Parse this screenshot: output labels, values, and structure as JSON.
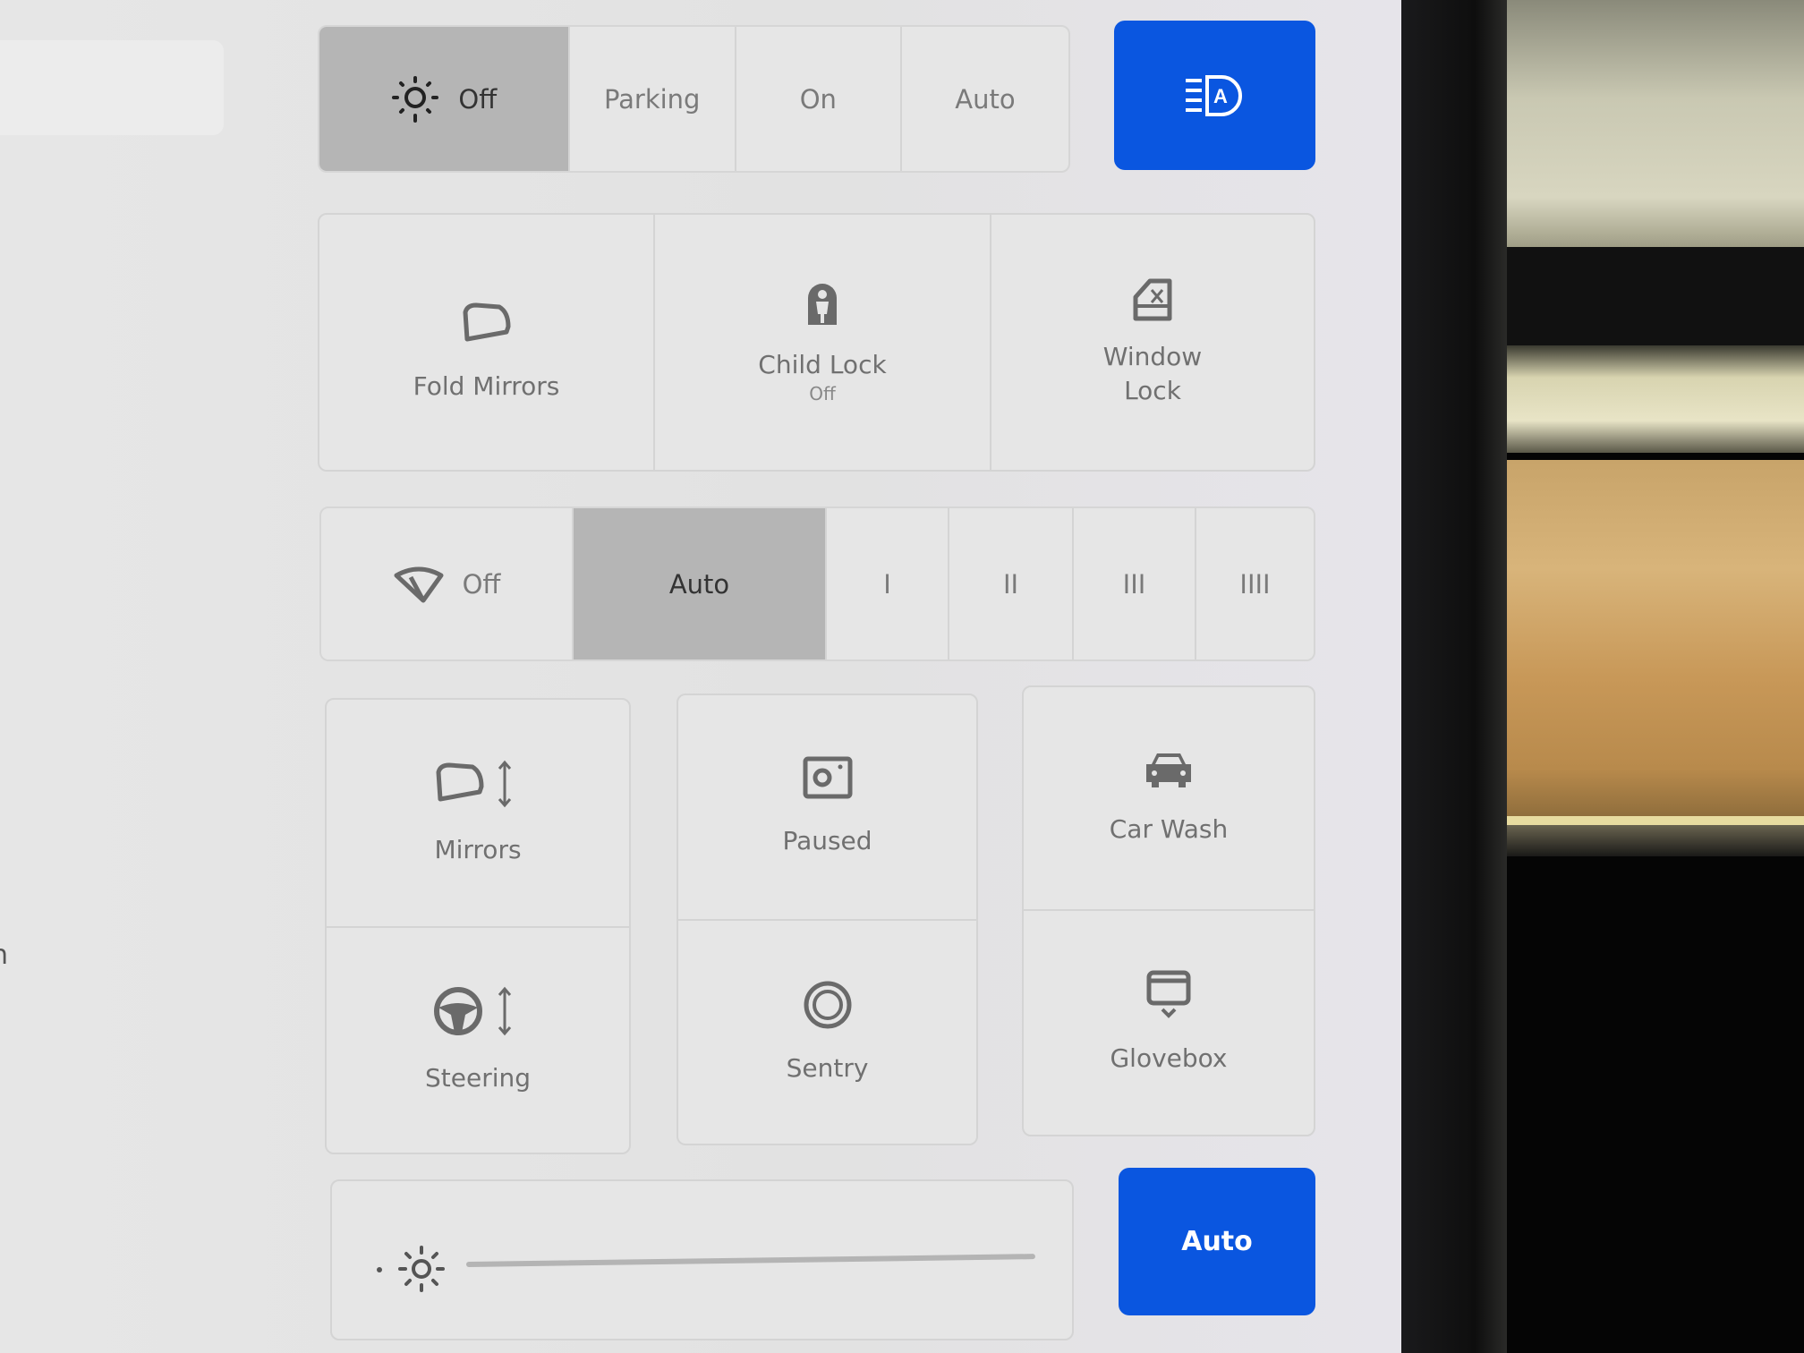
{
  "headlights": {
    "options": [
      "Off",
      "Parking",
      "On",
      "Auto"
    ],
    "selected": "Off",
    "auto_high_beam_icon": "auto-headlight-icon",
    "accent": "#0a56e0"
  },
  "controls": [
    {
      "label": "Fold Mirrors",
      "icon": "mirror-icon"
    },
    {
      "label": "Child Lock",
      "status": "Off",
      "icon": "child-lock-icon"
    },
    {
      "label": "Window\nLock",
      "icon": "window-lock-icon"
    }
  ],
  "wipers": {
    "options": [
      "Off",
      "Auto",
      "I",
      "II",
      "III",
      "IIII"
    ],
    "selected": "Auto",
    "icon": "wiper-icon"
  },
  "grid": [
    {
      "label": "Mirrors",
      "icon": "mirror-adjust-icon"
    },
    {
      "label": "Paused",
      "icon": "dashcam-icon"
    },
    {
      "label": "Car Wash",
      "icon": "car-icon"
    },
    {
      "label": "Steering",
      "icon": "steering-adjust-icon"
    },
    {
      "label": "Sentry",
      "icon": "sentry-icon"
    },
    {
      "label": "Glovebox",
      "icon": "glovebox-icon"
    }
  ],
  "brightness": {
    "auto_label": "Auto",
    "icon": "brightness-icon",
    "level": 1.0
  },
  "left_fragment": "n"
}
